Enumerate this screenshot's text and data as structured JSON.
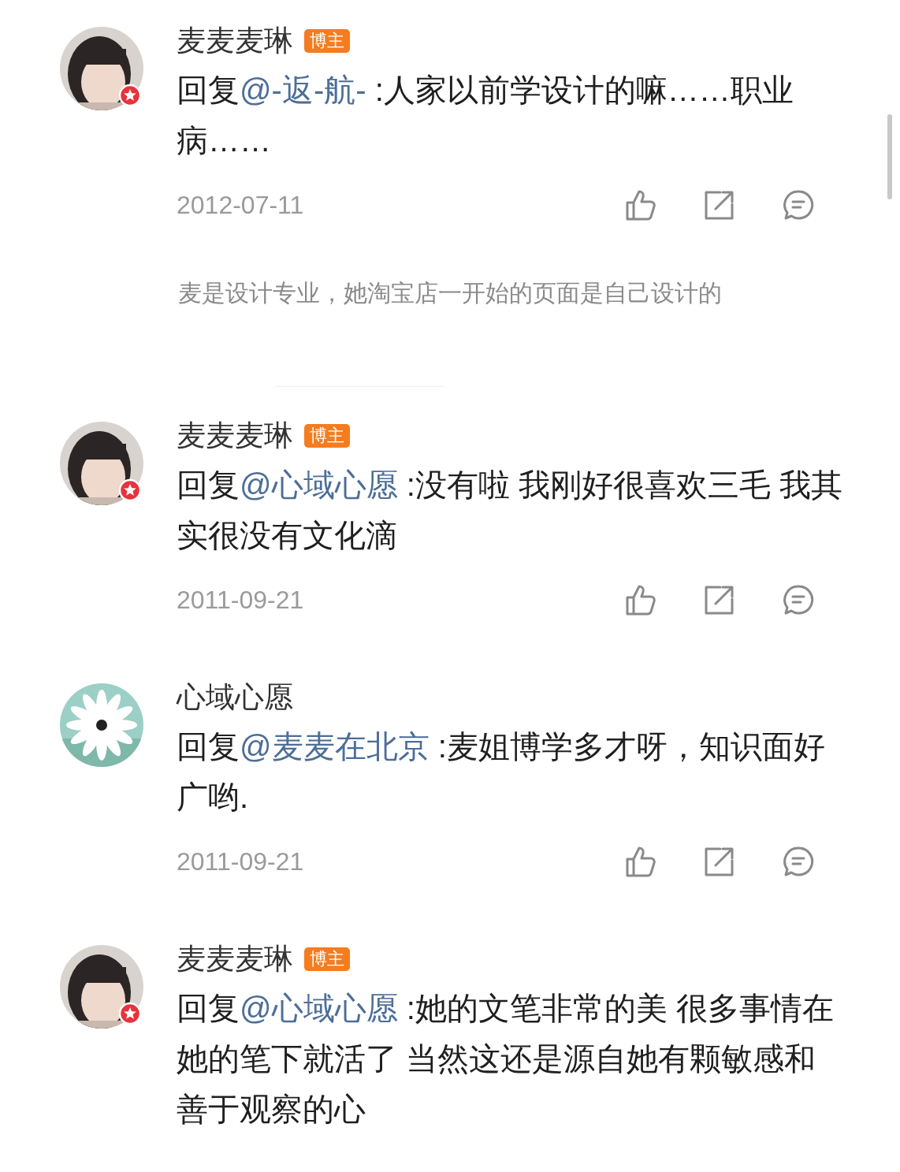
{
  "feed": [
    {
      "kind": "comment",
      "verified": true,
      "name": "麦麦麦琳",
      "badge": "博主",
      "prefix": "回复",
      "mention": "@-返-航-",
      "text": " :人家以前学设计的嘛……职业病……",
      "date": "2012-07-11"
    },
    {
      "kind": "note",
      "text": "麦是设计专业，她淘宝店一开始的页面是自己设计的"
    },
    {
      "kind": "comment",
      "verified": true,
      "name": "麦麦麦琳",
      "badge": "博主",
      "prefix": "回复",
      "mention": "@心域心愿",
      "text": " :没有啦 我刚好很喜欢三毛 我其实很没有文化滴",
      "date": "2011-09-21"
    },
    {
      "kind": "comment",
      "verified": false,
      "name": "心域心愿",
      "prefix": "回复",
      "mention": "@麦麦在北京",
      "text": " :麦姐博学多才呀，知识面好广哟.",
      "date": "2011-09-21"
    },
    {
      "kind": "comment",
      "verified": true,
      "name": "麦麦麦琳",
      "badge": "博主",
      "prefix": "回复",
      "mention": "@心域心愿",
      "text": " :她的文笔非常的美 很多事情在她的笔下就活了 当然这还是源自她有颗敏感和善于观察的心"
    }
  ]
}
